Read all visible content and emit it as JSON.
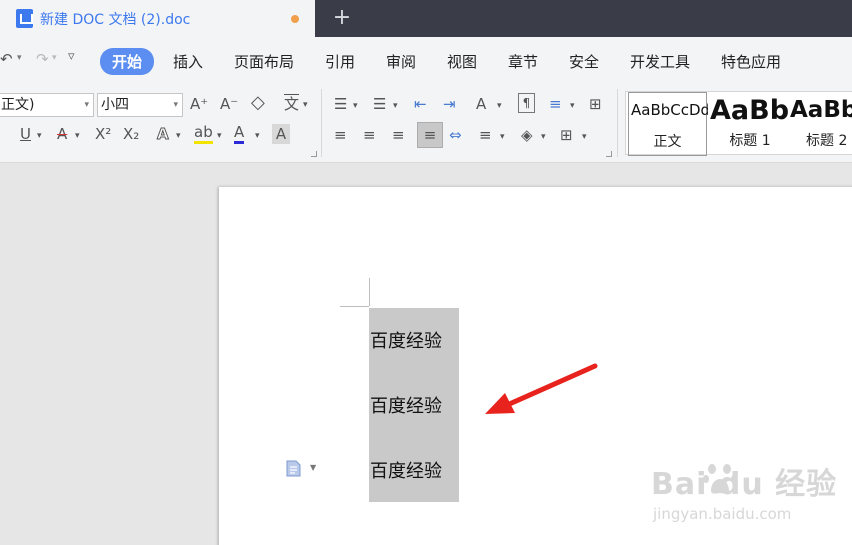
{
  "tab": {
    "title": "新建 DOC 文档 (2).doc",
    "new_tab": "+"
  },
  "quick_access": {
    "undo": "↶",
    "redo": "↷",
    "more": "▿"
  },
  "menu": {
    "items": [
      "开始",
      "插入",
      "页面布局",
      "引用",
      "审阅",
      "视图",
      "章节",
      "安全",
      "开发工具",
      "特色应用"
    ],
    "active_index": 0
  },
  "ribbon": {
    "font_name": "正文)",
    "font_size": "小四",
    "grow_font": "A⁺",
    "shrink_font": "A⁻",
    "eraser": "◇",
    "phonetic": "文",
    "underline": "U",
    "strike": "A",
    "superscript": "X²",
    "subscript": "X₂",
    "text_effect": "A",
    "highlight": "ab",
    "font_color": "A",
    "char_shade": "A",
    "bullets": "☰",
    "numbering": "☰",
    "outdent": "⇤",
    "indent": "⇥",
    "sort_text": "A",
    "show_marks": "¶",
    "line_spacing_icon": "≡",
    "align_left": "≡",
    "align_center": "≡",
    "align_right": "≡",
    "justify": "≡",
    "distribute": "⇔",
    "spacing": "≡",
    "shading": "◈",
    "borders": "⊞",
    "styles": [
      {
        "sample": "AaBbCcDd",
        "name": "正文"
      },
      {
        "sample": "AaBb",
        "name": "标题 1"
      },
      {
        "sample": "AaBb",
        "name": "标题 2"
      }
    ]
  },
  "document": {
    "lines": [
      "百度经验",
      "百度经验",
      "百度经验"
    ]
  },
  "watermark": {
    "brand": "Bai   du 经验",
    "url": "jingyan.baidu.com"
  },
  "colors": {
    "accent": "#5b8ef0",
    "arrow": "#e8231d",
    "tab_text": "#3d79ee",
    "titlebar": "#3a3d47"
  }
}
